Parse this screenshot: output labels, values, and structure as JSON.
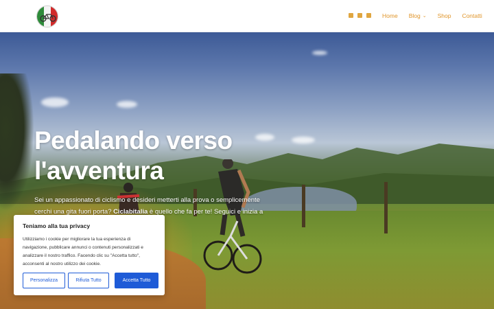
{
  "header": {
    "logo_alt": "Ciclabitalia",
    "socials": [
      "facebook-icon",
      "instagram-icon",
      "email-icon"
    ],
    "nav": [
      {
        "label": "Home"
      },
      {
        "label": "Blog"
      },
      {
        "label": "Shop"
      },
      {
        "label": "Contatti"
      }
    ]
  },
  "hero": {
    "title": "Pedalando verso l'avventura",
    "desc_part1": "Sei un appassionato di ciclismo e desideri metterti alla prova o semplicemente cerchi una gita fuori porta? ",
    "desc_bold": "Ciclabitalia",
    "desc_part2": " è quello che fa per te! Seguici e inizia a pedalare!"
  },
  "cookie": {
    "title": "Teniamo alla tua privacy",
    "text": "Utilizziamo i cookie per migliorare la tua esperienza di navigazione, pubblicare annunci o contenuti personalizzati e analizzare il nostro traffico. Facendo clic su \"Accetta tutto\", acconsenti al nostro utilizzo dei cookie.",
    "buttons": {
      "customize": "Personalizza",
      "reject": "Rifiuta Tutto",
      "accept": "Accetta Tutto"
    }
  },
  "colors": {
    "accent": "#e0952a",
    "primary_blue": "#1e5bd7"
  }
}
